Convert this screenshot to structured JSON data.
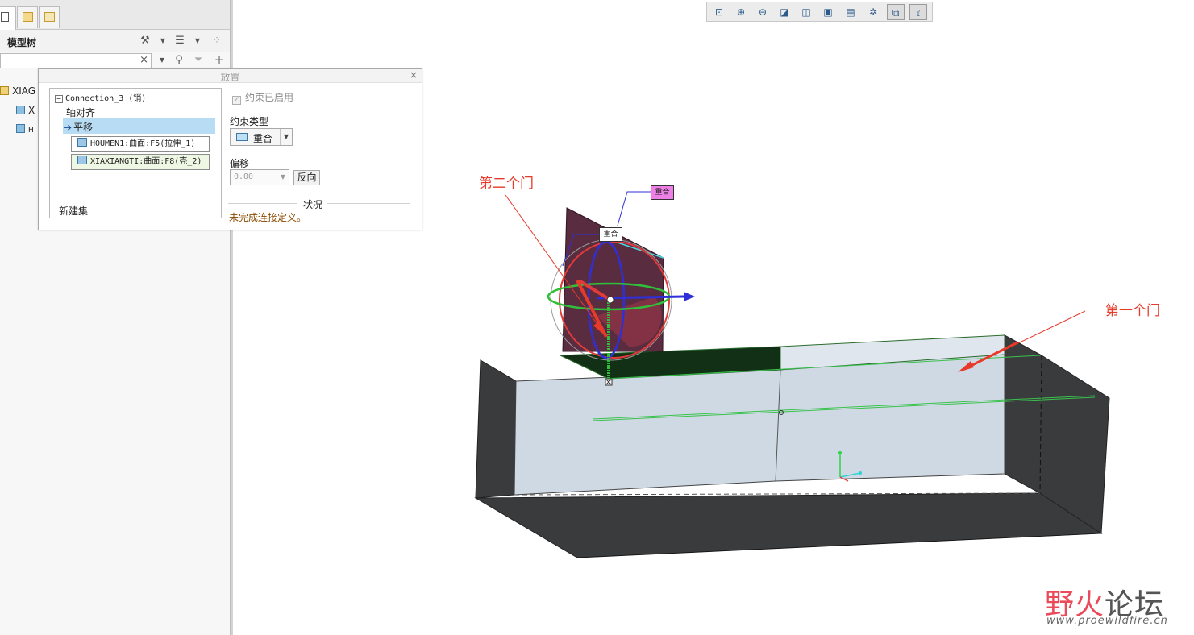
{
  "model_tree": {
    "title": "模型树",
    "tree_items": [
      {
        "label": "XIAG"
      },
      {
        "label": "X"
      },
      {
        "label": "H"
      }
    ]
  },
  "dialog": {
    "title": "放置",
    "connection_label": "Connection_3 (销)",
    "constraints": [
      {
        "label": "轴对齐"
      },
      {
        "label": "平移"
      }
    ],
    "references": [
      {
        "text": "HOUMEN1:曲面:F5(拉伸_1)"
      },
      {
        "text": "XIAXIANGTI:曲面:F8(壳_2)"
      }
    ],
    "new_set_label": "新建集",
    "constraint_enabled_label": "约束已启用",
    "constraint_type_label": "约束类型",
    "constraint_type_value": "重合",
    "offset_label": "偏移",
    "offset_value": "0.00",
    "flip_button": "反向",
    "status_label": "状况",
    "status_text": "未完成连接定义。"
  },
  "annotations": {
    "second_door": "第二个门",
    "first_door": "第一个门",
    "tag_pink": "重合",
    "tag_white": "重合"
  },
  "watermark": {
    "logo_text_1": "野火",
    "logo_text_2": "论坛",
    "url": "www.proewildfire.cn"
  },
  "colors": {
    "annotation_red": "#e83a2a",
    "selection_blue": "#b7dcf3",
    "model_dark": "#3a3b3d",
    "model_light": "#cfd9e4",
    "door_purple": "#5a2c40"
  }
}
